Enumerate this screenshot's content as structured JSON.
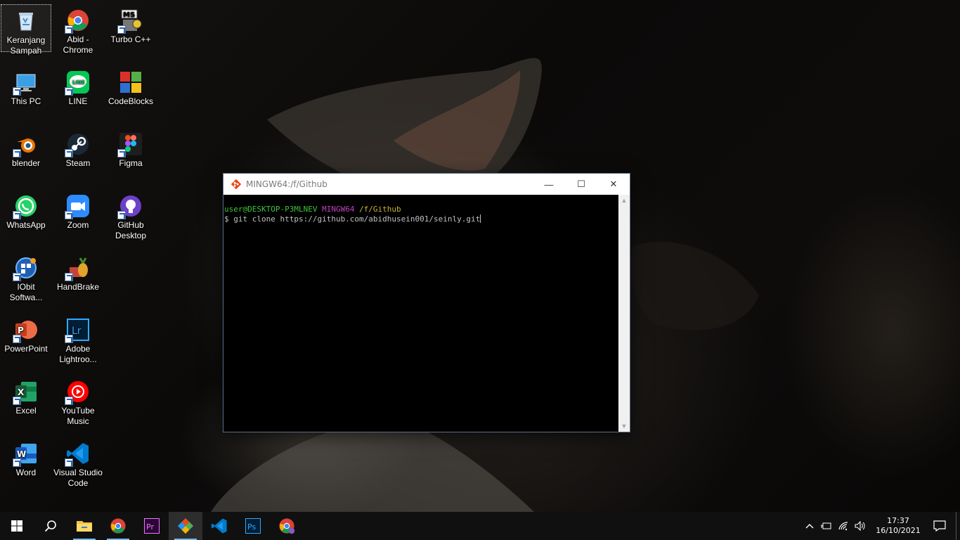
{
  "desktop": {
    "icons": [
      {
        "label": "Keranjang Sampah",
        "icon": "recycle-bin-icon"
      },
      {
        "label": "Abid - Chrome",
        "icon": "chrome-icon"
      },
      {
        "label": "Turbo C++",
        "icon": "turbo-cpp-icon"
      },
      {
        "label": "This PC",
        "icon": "this-pc-icon"
      },
      {
        "label": "LINE",
        "icon": "line-icon"
      },
      {
        "label": "CodeBlocks",
        "icon": "codeblocks-icon"
      },
      {
        "label": "blender",
        "icon": "blender-icon"
      },
      {
        "label": "Steam",
        "icon": "steam-icon"
      },
      {
        "label": "Figma",
        "icon": "figma-icon"
      },
      {
        "label": "WhatsApp",
        "icon": "whatsapp-icon"
      },
      {
        "label": "Zoom",
        "icon": "zoom-icon"
      },
      {
        "label": "GitHub Desktop",
        "icon": "github-desktop-icon"
      },
      {
        "label": "IObit Softwa...",
        "icon": "iobit-icon"
      },
      {
        "label": "HandBrake",
        "icon": "handbrake-icon"
      },
      {
        "label": "PowerPoint",
        "icon": "powerpoint-icon"
      },
      {
        "label": "Adobe Lightroo...",
        "icon": "lightroom-icon"
      },
      {
        "label": "Excel",
        "icon": "excel-icon"
      },
      {
        "label": "YouTube Music",
        "icon": "youtube-music-icon"
      },
      {
        "label": "Word",
        "icon": "word-icon"
      },
      {
        "label": "Visual Studio Code",
        "icon": "vscode-icon"
      }
    ]
  },
  "window": {
    "title": "MINGW64:/f/Github",
    "minimize_glyph": "—",
    "maximize_glyph": "☐",
    "close_glyph": "✕",
    "prompt_user": "user@DESKTOP-P3MLNEV",
    "prompt_host": "MINGW64",
    "prompt_path": "/f/Github",
    "command": "$ git clone https://github.com/abidhusein001/seinly.git",
    "scroll_up_glyph": "▲",
    "scroll_down_glyph": "▼"
  },
  "taskbar": {
    "pinned": [
      {
        "name": "start-button",
        "icon": "windows-logo-icon"
      },
      {
        "name": "search-button",
        "icon": "search-icon"
      },
      {
        "name": "file-explorer-button",
        "icon": "folder-icon"
      },
      {
        "name": "chrome-button",
        "icon": "chrome-icon"
      },
      {
        "name": "premiere-button",
        "icon": "premiere-pro-icon",
        "text": "Pr"
      },
      {
        "name": "git-bash-button",
        "icon": "git-icon"
      },
      {
        "name": "vscode-button",
        "icon": "vscode-icon"
      },
      {
        "name": "photoshop-button",
        "icon": "photoshop-icon",
        "text": "Ps"
      },
      {
        "name": "chrome-profile-button",
        "icon": "chrome-icon"
      }
    ],
    "time": "17:37",
    "date": "16/10/2021"
  },
  "colors": {
    "accent": "#76b9ed",
    "prompt_user": "#3fc33f",
    "prompt_host": "#bf40bf",
    "prompt_path": "#c8b53a"
  }
}
